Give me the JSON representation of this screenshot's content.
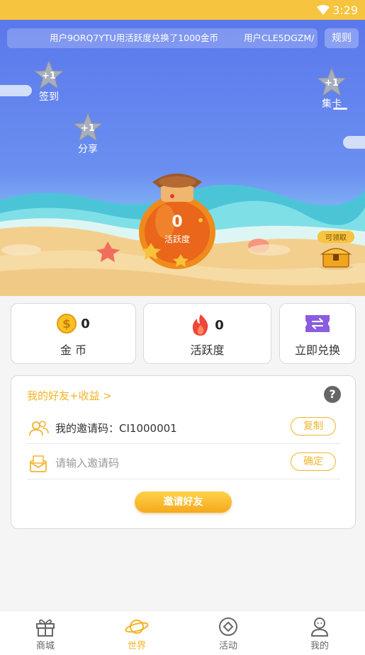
{
  "status_bar": {
    "time": "3:29"
  },
  "hero": {
    "ticker": [
      "用户9ORQ7YTU用活跃度兑换了1000金币",
      "用户CLE5DGZM/"
    ],
    "rules_label": "规则",
    "stars": [
      {
        "id": "checkin",
        "badge": "+1",
        "label": "签到"
      },
      {
        "id": "share",
        "badge": "+1",
        "label": "分享"
      },
      {
        "id": "collect",
        "badge": "+1",
        "label": "集卡"
      }
    ],
    "bottle": {
      "value": "0",
      "label": "活跃度"
    },
    "chest_badge": "可领取"
  },
  "stats": {
    "coins": {
      "value": "0",
      "label": "金 币"
    },
    "activity": {
      "value": "0",
      "label": "活跃度"
    },
    "redeem": {
      "label": "立即兑换"
    }
  },
  "friends": {
    "title": "我的好友+收益 >",
    "invite_code_label": "我的邀请码：CI1000001",
    "copy_label": "复制",
    "input_placeholder": "请输入邀请码",
    "confirm_label": "确定",
    "invite_button": "邀请好友"
  },
  "nav": [
    {
      "id": "mall",
      "label": "商城",
      "icon": "gift-icon"
    },
    {
      "id": "world",
      "label": "世界",
      "icon": "planet-icon",
      "active": true
    },
    {
      "id": "activity",
      "label": "活动",
      "icon": "diamond-circle-icon"
    },
    {
      "id": "mine",
      "label": "我的",
      "icon": "user-icon"
    }
  ],
  "colors": {
    "accent": "#f5b324",
    "status_bar": "#f7c43f",
    "sky": "#5b78ec"
  }
}
